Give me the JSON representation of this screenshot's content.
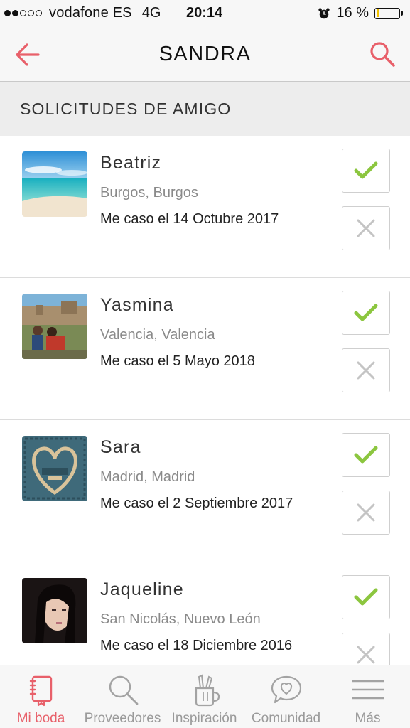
{
  "status_bar": {
    "carrier": "vodafone ES",
    "network": "4G",
    "time": "20:14",
    "battery_text": "16 %",
    "battery_level": 0.16
  },
  "header": {
    "title": "SANDRA",
    "back_icon": "arrow-left-icon",
    "search_icon": "search-icon",
    "accent_color": "#e8606a"
  },
  "section": {
    "title": "SOLICITUDES DE AMIGO"
  },
  "requests": [
    {
      "name": "Beatriz",
      "location": "Burgos, Burgos",
      "date": "Me caso el 14 Octubre 2017"
    },
    {
      "name": "Yasmina",
      "location": "Valencia, Valencia",
      "date": "Me caso el 5 Mayo 2018"
    },
    {
      "name": "Sara",
      "location": "Madrid, Madrid",
      "date": "Me caso el 2 Septiembre 2017"
    },
    {
      "name": "Jaqueline",
      "location": "San Nicolás, Nuevo León",
      "date": "Me caso el 18 Diciembre 2016"
    }
  ],
  "actions": {
    "accept_icon": "check-icon",
    "accept_color": "#8cc63f",
    "reject_icon": "close-icon",
    "reject_color": "#c4c4c4"
  },
  "tabs": [
    {
      "label": "Mi boda",
      "icon": "notebook-icon",
      "active": true
    },
    {
      "label": "Proveedores",
      "icon": "search-icon",
      "active": false
    },
    {
      "label": "Inspiración",
      "icon": "pencil-cup-icon",
      "active": false
    },
    {
      "label": "Comunidad",
      "icon": "heart-chat-icon",
      "active": false
    },
    {
      "label": "Más",
      "icon": "menu-icon",
      "active": false
    }
  ]
}
